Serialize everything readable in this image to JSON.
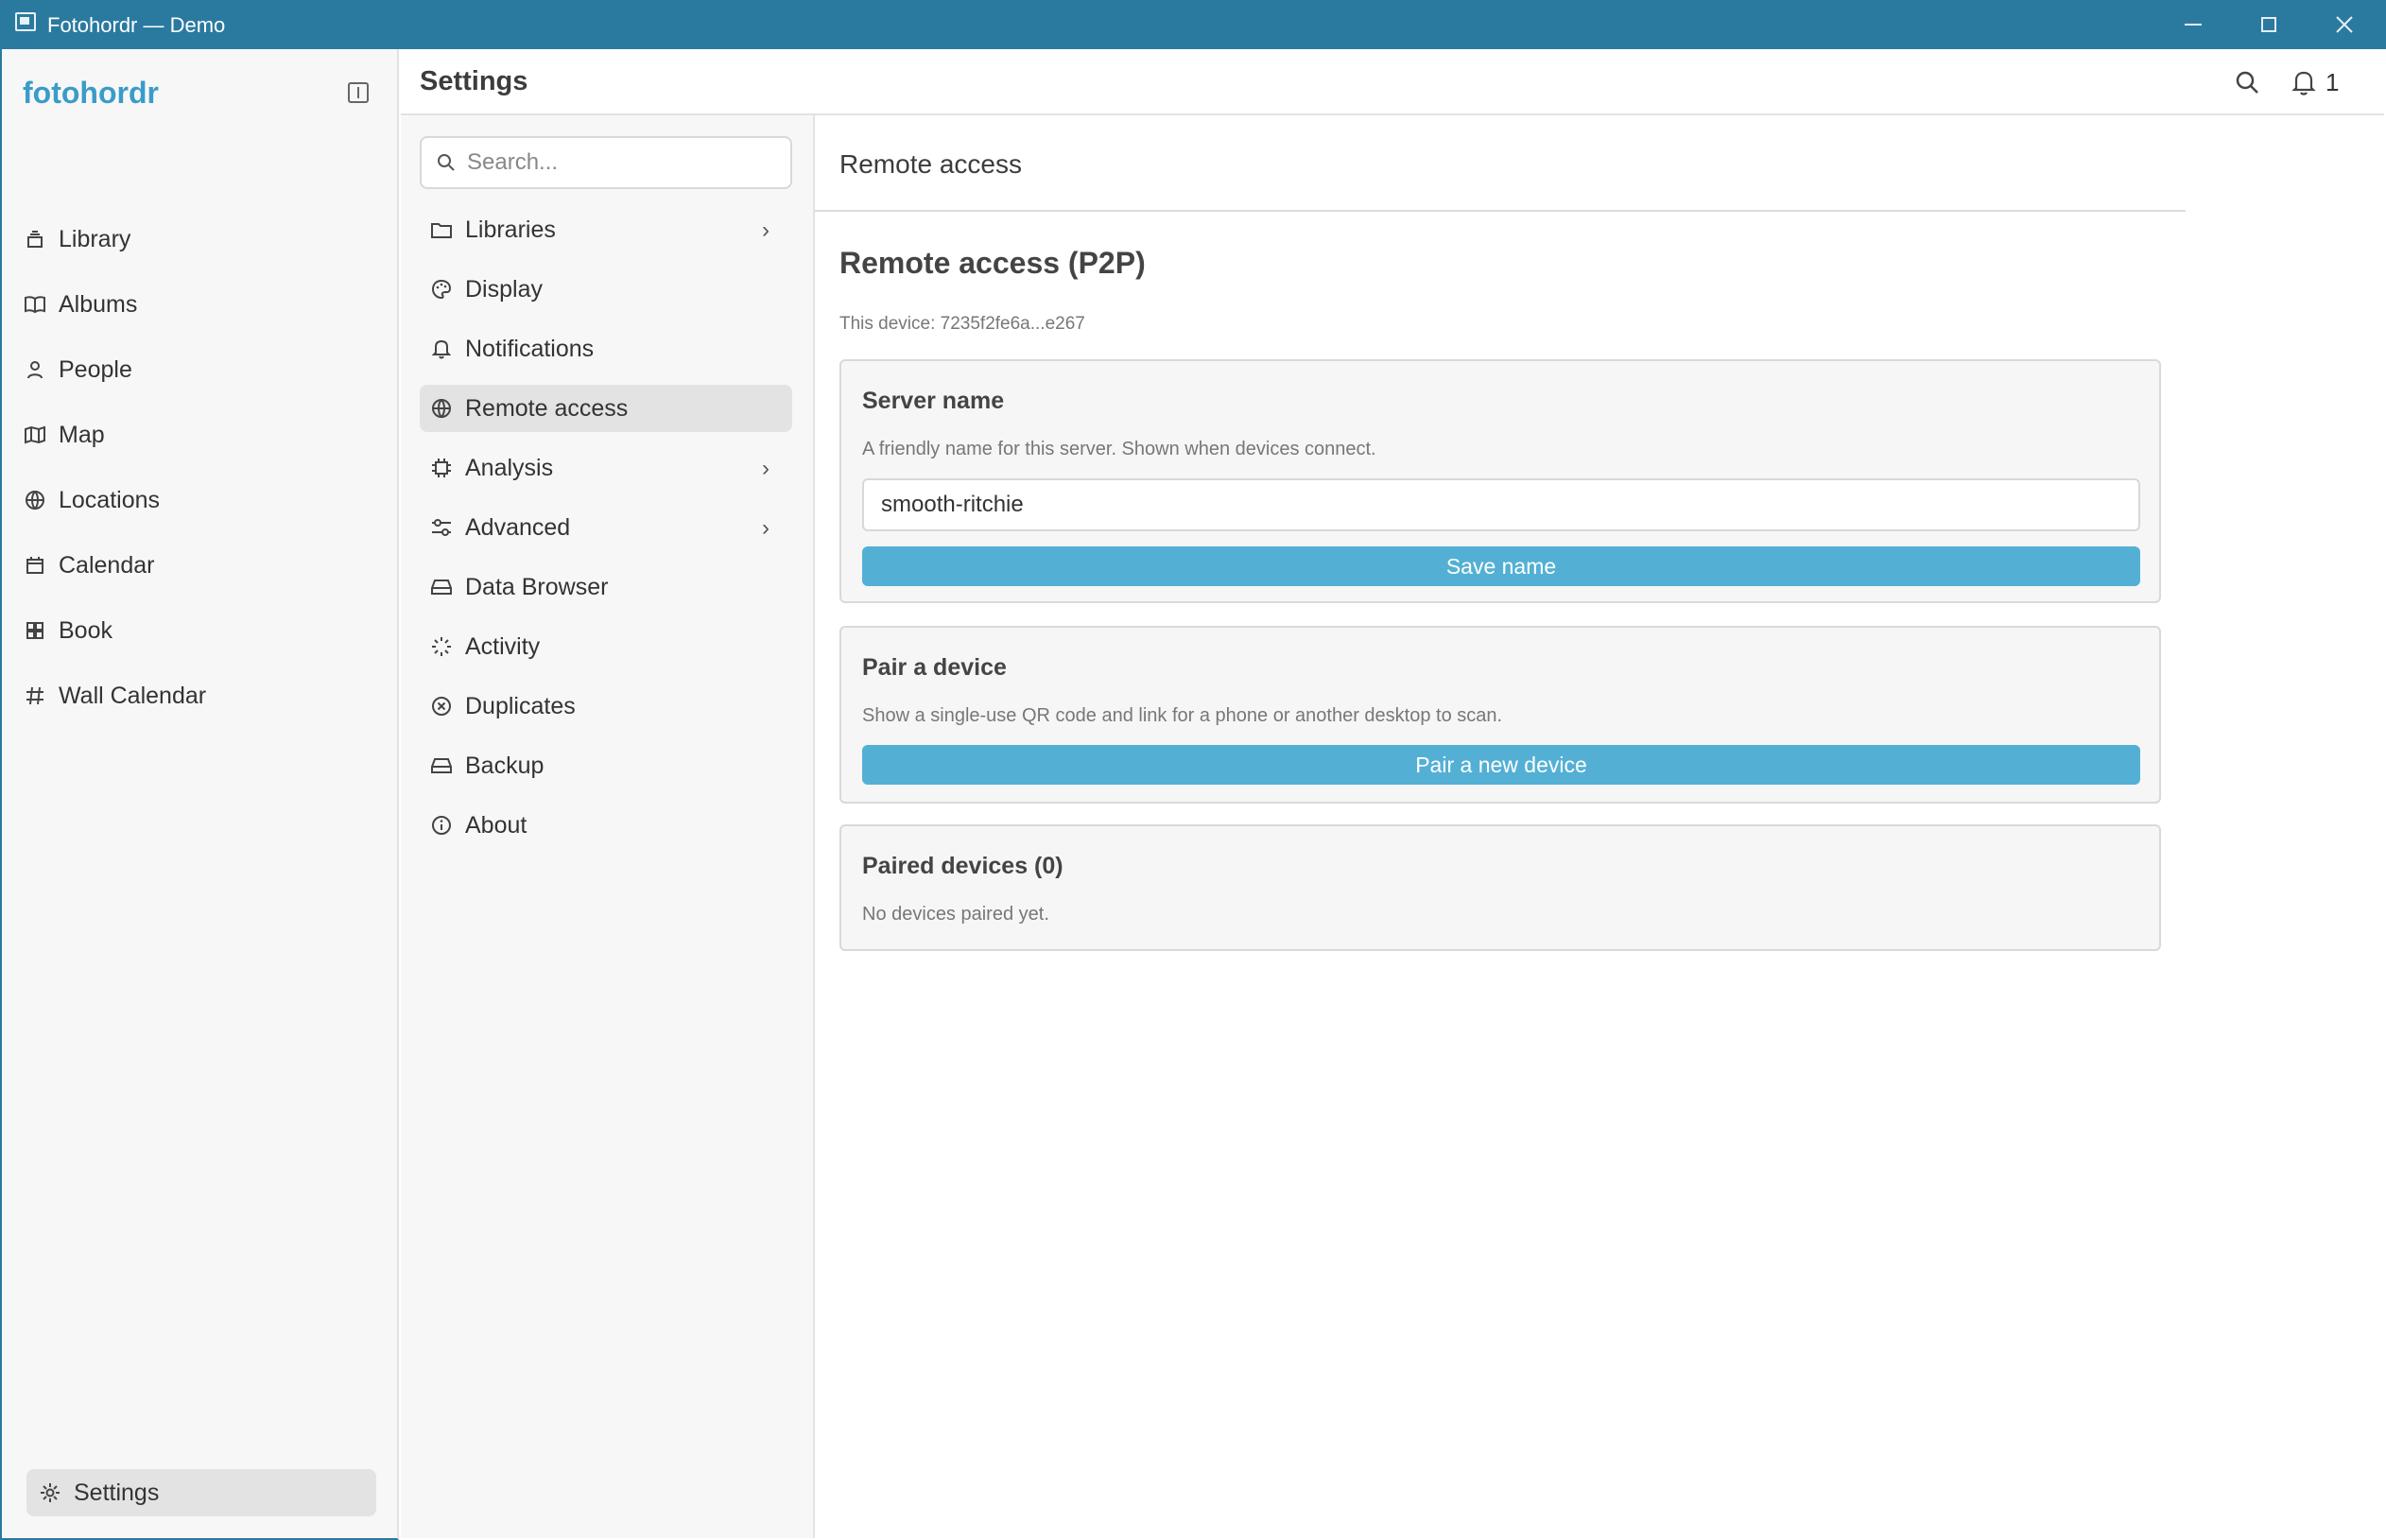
{
  "window": {
    "title": "Fotohordr — Demo"
  },
  "sidebar": {
    "brand": "fotohordr",
    "items": [
      {
        "label": "Library",
        "icon": "library-icon"
      },
      {
        "label": "Albums",
        "icon": "book-open-icon"
      },
      {
        "label": "People",
        "icon": "person-icon"
      },
      {
        "label": "Map",
        "icon": "map-icon"
      },
      {
        "label": "Locations",
        "icon": "globe-icon"
      },
      {
        "label": "Calendar",
        "icon": "calendar-icon"
      },
      {
        "label": "Book",
        "icon": "grid-icon"
      },
      {
        "label": "Wall Calendar",
        "icon": "hash-icon"
      }
    ],
    "settings_label": "Settings"
  },
  "header": {
    "title": "Settings",
    "notification_count": "1"
  },
  "subnav": {
    "search_placeholder": "Search...",
    "items": [
      {
        "label": "Libraries",
        "has_chevron": true
      },
      {
        "label": "Display",
        "has_chevron": false
      },
      {
        "label": "Notifications",
        "has_chevron": false
      },
      {
        "label": "Remote access",
        "has_chevron": false,
        "active": true
      },
      {
        "label": "Analysis",
        "has_chevron": true
      },
      {
        "label": "Advanced",
        "has_chevron": true
      },
      {
        "label": "Data Browser",
        "has_chevron": false
      },
      {
        "label": "Activity",
        "has_chevron": false
      },
      {
        "label": "Duplicates",
        "has_chevron": false
      },
      {
        "label": "Backup",
        "has_chevron": false
      },
      {
        "label": "About",
        "has_chevron": false
      }
    ]
  },
  "content": {
    "section_title": "Remote access",
    "heading": "Remote access (P2P)",
    "device_label": "This device: 7235f2fe6a...e267",
    "server_name": {
      "title": "Server name",
      "description": "A friendly name for this server. Shown when devices connect.",
      "value": "smooth-ritchie",
      "button": "Save name"
    },
    "pair": {
      "title": "Pair a device",
      "description": "Show a single-use QR code and link for a phone or another desktop to scan.",
      "button": "Pair a new device"
    },
    "paired": {
      "title": "Paired devices (0)",
      "description": "No devices paired yet."
    }
  },
  "colors": {
    "titlebar": "#2a7aa0",
    "brand": "#3a9cc8",
    "button": "#53b0d4"
  }
}
